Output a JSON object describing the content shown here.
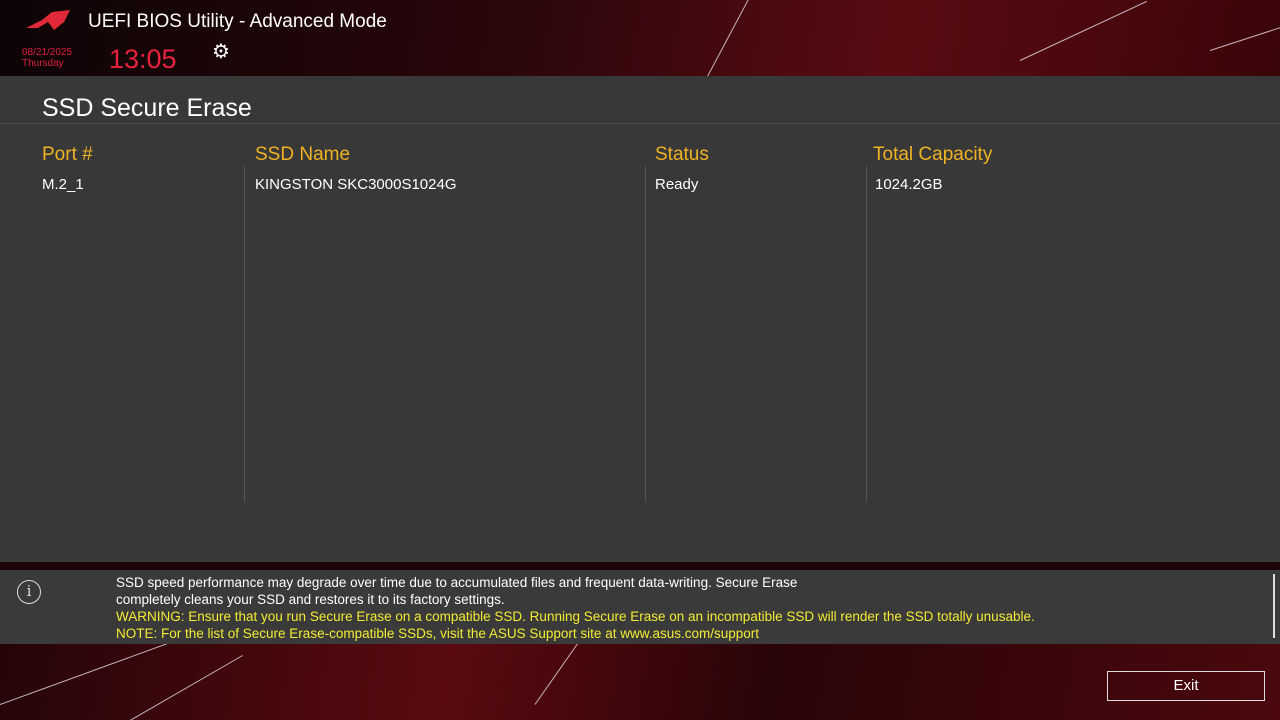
{
  "header": {
    "title": "UEFI BIOS Utility - Advanced Mode",
    "date": "08/21/2025",
    "day": "Thursday",
    "time": "13:05"
  },
  "page": {
    "title": "SSD Secure Erase"
  },
  "table": {
    "columns": [
      "Port #",
      "SSD Name",
      "Status",
      "Total Capacity"
    ],
    "rows": [
      [
        "M.2_1",
        "KINGSTON SKC3000S1024G",
        "Ready",
        "1024.2GB"
      ]
    ]
  },
  "info": {
    "line1": "SSD speed performance may degrade over time due to accumulated files and frequent data-writing. Secure Erase",
    "line2": "completely cleans your SSD and restores it to its factory settings.",
    "warning": "WARNING: Ensure that you run Secure Erase on a compatible SSD. Running Secure Erase on an incompatible SSD will render the SSD totally unusable.",
    "note": "NOTE: For the list of Secure Erase-compatible SSDs, visit the ASUS Support site at www.asus.com/support"
  },
  "footer": {
    "exit_label": "Exit"
  },
  "colors": {
    "accent": "#f0b323",
    "time": "#e8213f",
    "warning": "#f3ec33"
  }
}
